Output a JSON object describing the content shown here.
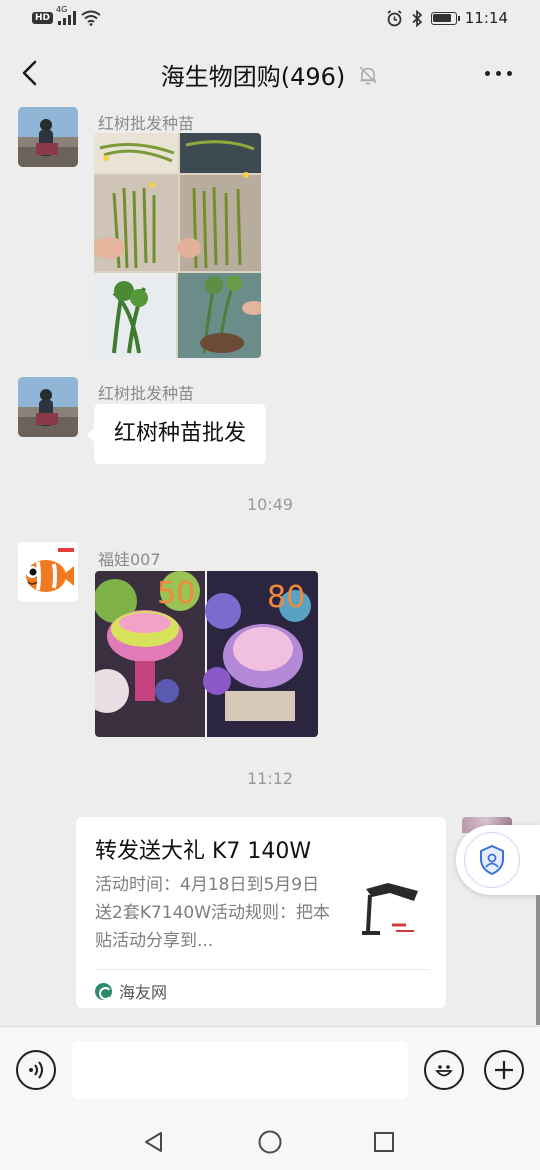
{
  "status_bar": {
    "network": "4G",
    "hd_badge": "HD",
    "time": "11:14",
    "battery_level": 0.85
  },
  "header": {
    "title": "海生物团购(496)"
  },
  "messages": [
    {
      "sender": "红树批发种苗",
      "type": "image"
    },
    {
      "sender": "红树批发种苗",
      "type": "text",
      "text": "红树种苗批发"
    },
    {
      "type": "time",
      "text": "10:49"
    },
    {
      "sender": "福娃007",
      "type": "image",
      "overlay_left": "50",
      "overlay_right": "80"
    },
    {
      "type": "time",
      "text": "11:12"
    }
  ],
  "share_card": {
    "title": "转发送大礼 K7 140W",
    "description": "活动时间：4月18日到5月9日送2套K7140W活动规则：把本贴活动分享到...",
    "source": "海友网"
  },
  "colors": {
    "background": "#ededed",
    "bubble": "#ffffff",
    "muted_text": "#8a8a8a"
  },
  "icons": [
    "back-arrow-icon",
    "mute-bell-icon",
    "more-icon",
    "voice-icon",
    "emoji-icon",
    "plus-icon",
    "shield-icon",
    "nav-back-icon",
    "nav-home-icon",
    "nav-recents-icon"
  ]
}
